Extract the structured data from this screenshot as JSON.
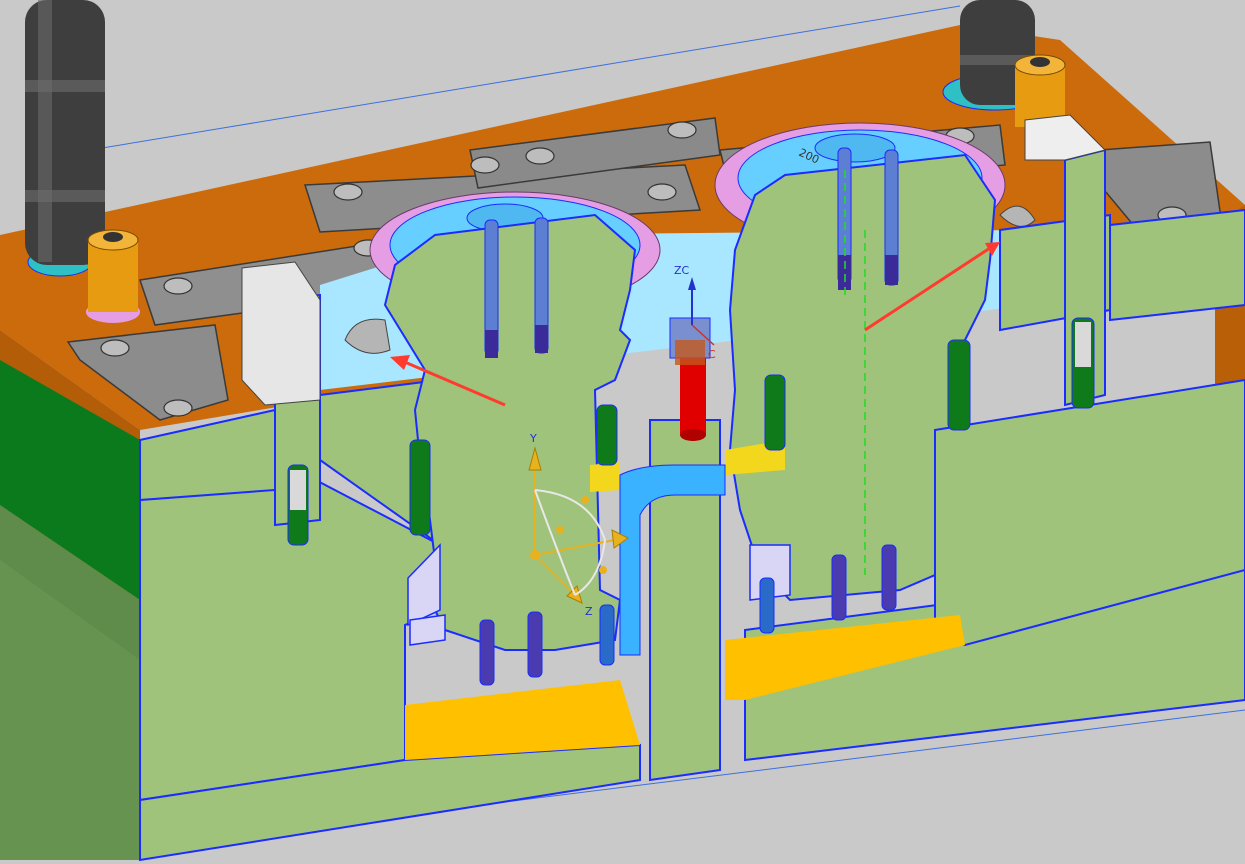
{
  "viewport": {
    "background": "#c9c9c9",
    "colors": {
      "plate_orange": "#c8690a",
      "plate_orange_dark": "#a55407",
      "section_green": "#9fc37a",
      "section_edge": "#1a2cff",
      "cavity_cyan": "#8fdcff",
      "insert_pink": "#e8a6e6",
      "yellow_plate": "#ffc000",
      "steel_gray": "#9a9a9a",
      "dark_green": "#0f7a1a",
      "leader_pin": "#4a4a4a",
      "screw_blue": "#2a53c9",
      "runner_red": "#e00000",
      "arrow_red": "#ff3b2f",
      "axis_yellow": "#e8b21f",
      "axis_blue": "#2233cc",
      "centerline_green": "#22dd22"
    }
  },
  "triad": {
    "y_label": "Y",
    "z_label": "Z"
  },
  "wcs": {
    "zc_label": "ZC",
    "c_label": "C"
  },
  "part_text": "200"
}
